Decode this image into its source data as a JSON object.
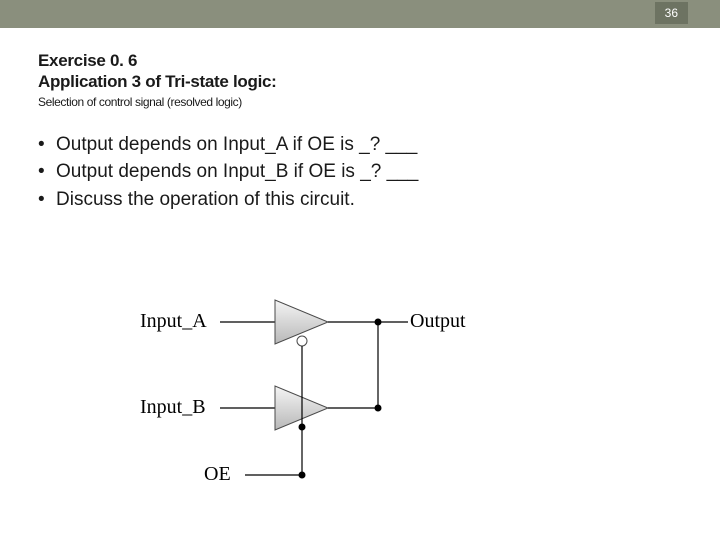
{
  "page": {
    "number": "36"
  },
  "heading": {
    "line1": "Exercise 0. 6",
    "line2": "Application 3 of Tri-state logic:",
    "sub": "Selection of control signal (resolved logic)"
  },
  "bullets": {
    "dot": "•",
    "b1": "Output depends on Input_A if OE is _? ___",
    "b2": "Output depends on Input_B if OE is _? ___",
    "b3": "Discuss the operation of this circuit."
  },
  "diagram": {
    "inA": "Input_A",
    "inB": "Input_B",
    "oe": "OE",
    "out": "Output"
  }
}
